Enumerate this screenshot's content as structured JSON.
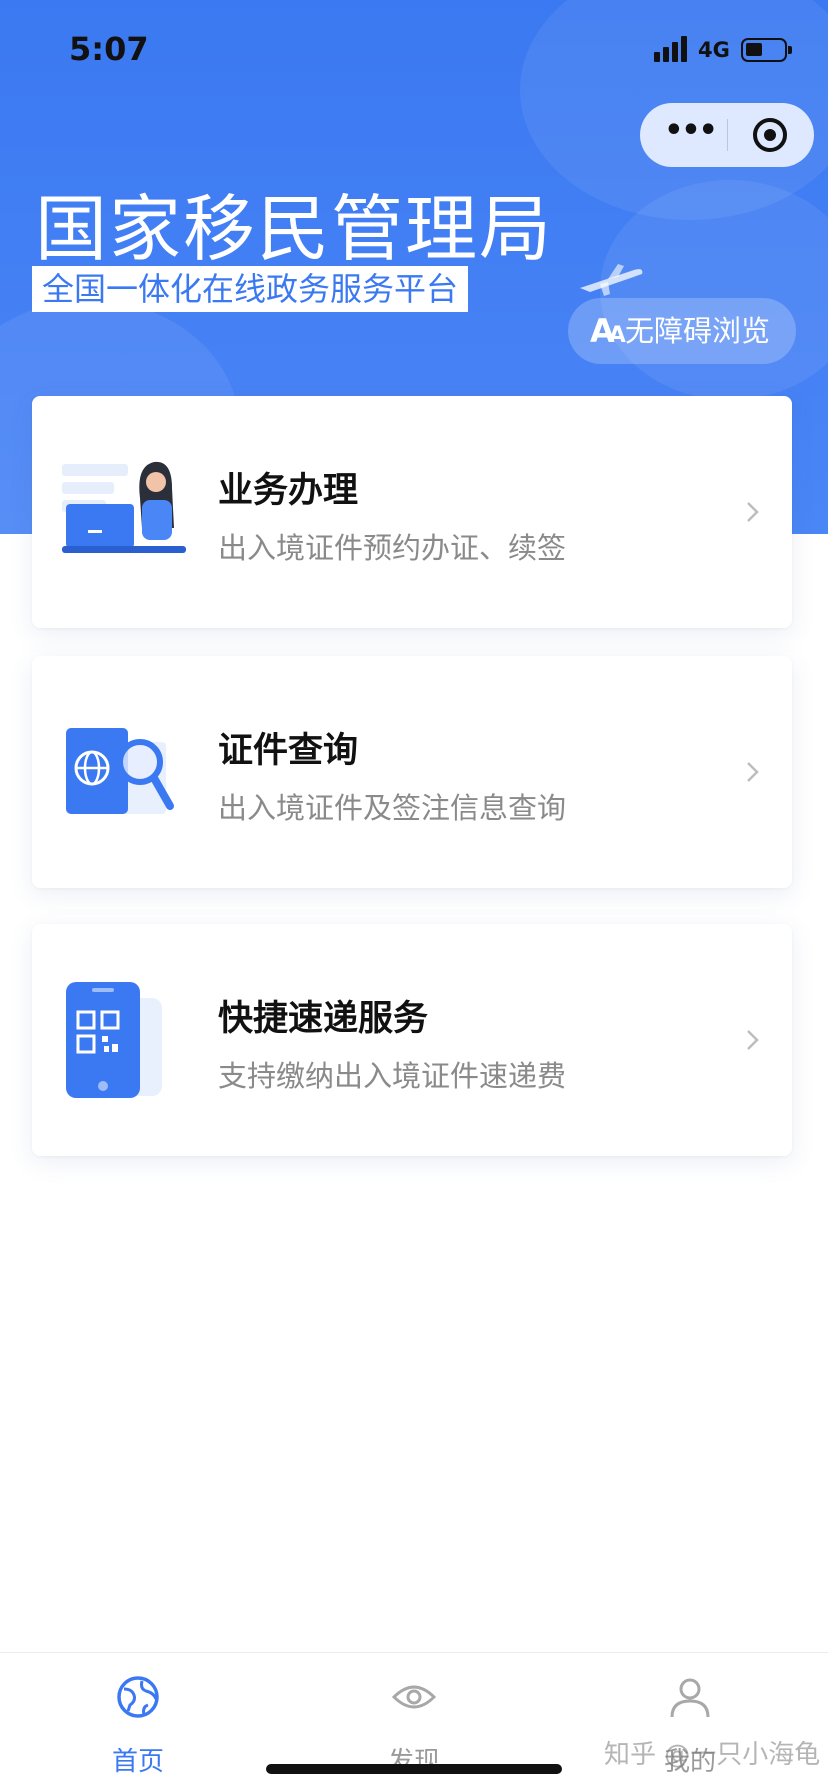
{
  "status_bar": {
    "time": "5:07",
    "network": "4G"
  },
  "header": {
    "title": "国家移民管理局",
    "subtitle": "全国一体化在线政务服务平台",
    "accessibility_button": "无障碍浏览",
    "accessibility_icon": "Aa",
    "brand_color": "#3b79f2"
  },
  "capsule": {
    "more_icon": "•••"
  },
  "cards": [
    {
      "title": "业务办理",
      "desc": "出入境证件预约办证、续签",
      "icon": "person-laptop-icon"
    },
    {
      "title": "证件查询",
      "desc": "出入境证件及签注信息查询",
      "icon": "passport-search-icon"
    },
    {
      "title": "快捷速递服务",
      "desc": "支持缴纳出入境证件速递费",
      "icon": "phone-qr-icon"
    }
  ],
  "tabbar": {
    "tabs": [
      {
        "label": "首页",
        "icon": "globe-icon",
        "active": true
      },
      {
        "label": "发现",
        "icon": "eye-icon",
        "active": false
      },
      {
        "label": "我的",
        "icon": "user-icon",
        "active": false
      }
    ]
  },
  "watermark": "知乎 @一只小海龟"
}
